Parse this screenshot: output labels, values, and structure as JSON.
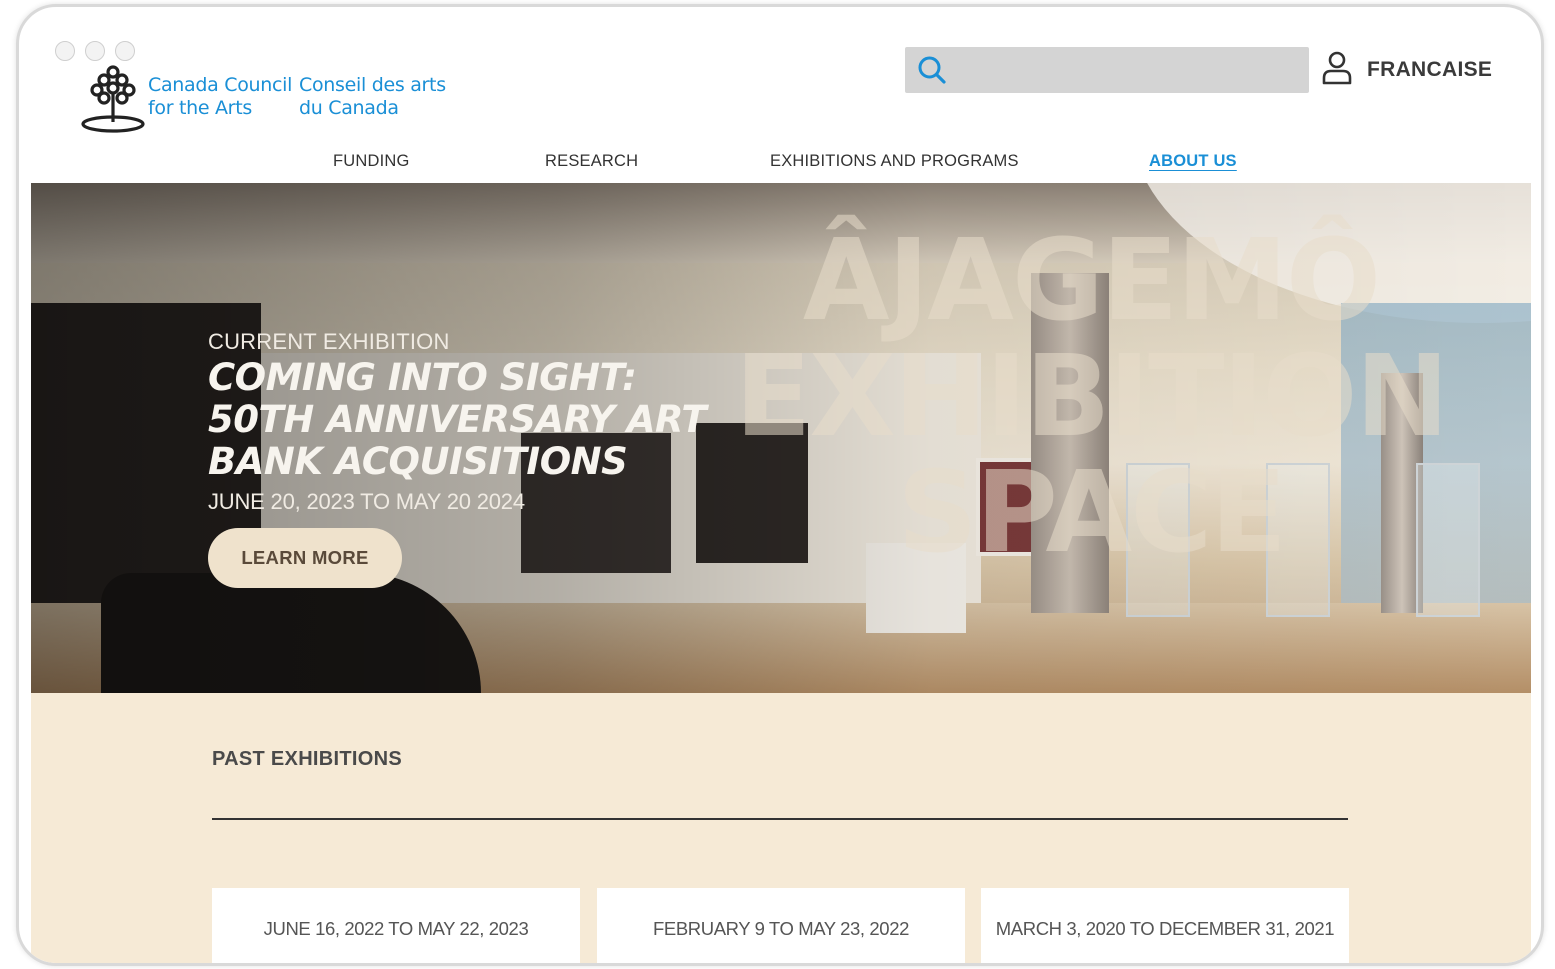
{
  "brand": {
    "en_line1": "Canada Council",
    "en_line2": "for the Arts",
    "fr_line1": "Conseil des arts",
    "fr_line2": "du Canada"
  },
  "header": {
    "search_placeholder": "",
    "language_link": "FRANCAISE"
  },
  "nav": {
    "items": [
      "FUNDING",
      "RESEARCH",
      "EXHIBITIONS AND PROGRAMS",
      "ABOUT US"
    ],
    "active": "ABOUT US"
  },
  "hero": {
    "watermark_line1": "ÂJAGEMÔ",
    "watermark_line2": "EXHIBITION",
    "watermark_line3": "SPACE",
    "eyebrow": "CURRENT EXHIBITION",
    "title": "COMING INTO SIGHT: 50TH ANNIVERSARY ART BANK ACQUISITIONS",
    "dates": "JUNE 20, 2023 TO MAY 20 2024",
    "cta_label": "LEARN MORE"
  },
  "past": {
    "heading": "PAST EXHIBITIONS",
    "cards": [
      {
        "dates": "JUNE 16, 2022 TO MAY 22, 2023"
      },
      {
        "dates": "FEBRUARY 9 TO MAY 23, 2022"
      },
      {
        "dates": "MARCH 3, 2020 TO DECEMBER 31, 2021"
      }
    ]
  },
  "colors": {
    "brand_blue": "#1a8fd6",
    "cta_beige": "#efe2cc",
    "section_bg": "#f6ead6"
  }
}
